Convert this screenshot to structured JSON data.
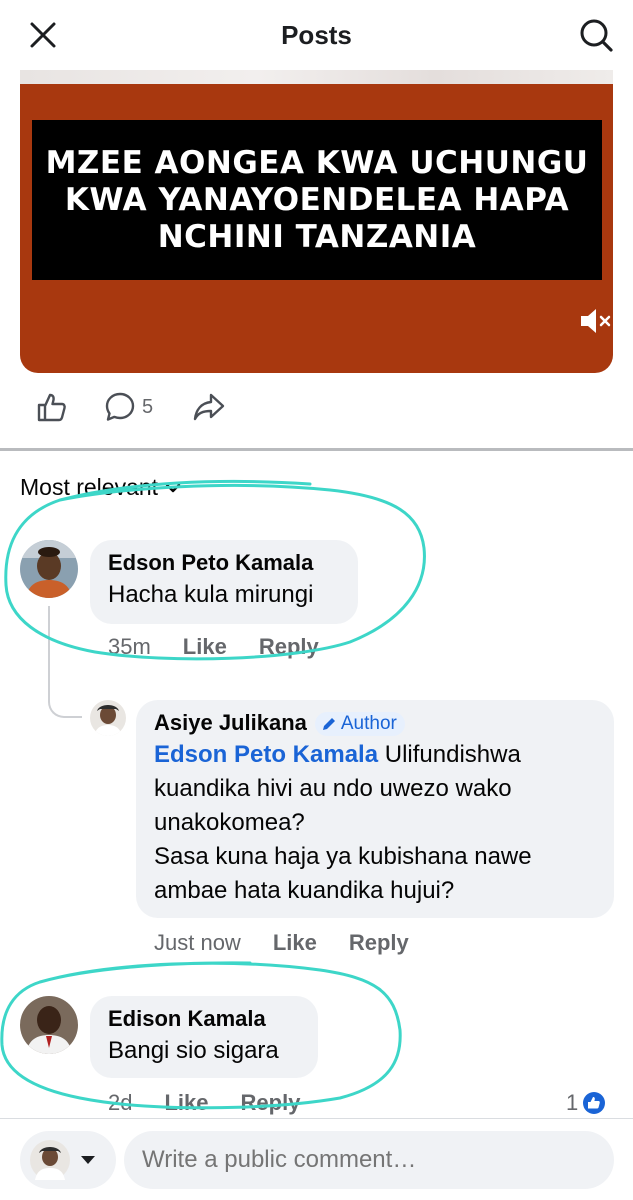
{
  "header": {
    "title": "Posts",
    "close_icon": "close-icon",
    "search_icon": "search-icon"
  },
  "post": {
    "banner_text": "MZEE AONGEA KWA UCHUNGU\nKWA YANAYOENDELEA HAPA\nNCHINI TANZANIA",
    "comment_count": "5",
    "colors": {
      "media_bg": "#a8380f",
      "banner_bg": "#000000"
    }
  },
  "sort": {
    "label": "Most relevant"
  },
  "comments": [
    {
      "name": "Edson Peto Kamala",
      "text": "Hacha kula mirungi",
      "time": "35m",
      "like": "Like",
      "reply": "Reply"
    },
    {
      "name": "Asiye Julikana",
      "badge": "Author",
      "mention": "Edson Peto Kamala",
      "text": " Ulifundishwa kuandika hivi au ndo uwezo wako unakokomea?\nSasa kuna haja ya kubishana nawe ambae hata kuandika hujui?",
      "time": "Just now",
      "like": "Like",
      "reply": "Reply"
    },
    {
      "name": "Edison Kamala",
      "text": "Bangi sio sigara",
      "time": "2d",
      "like": "Like",
      "reply": "Reply",
      "reactions": "1"
    }
  ],
  "composer": {
    "placeholder": "Write a public comment…"
  },
  "accent_color": "#1a64d6",
  "annotation_color": "#3dd6c8"
}
